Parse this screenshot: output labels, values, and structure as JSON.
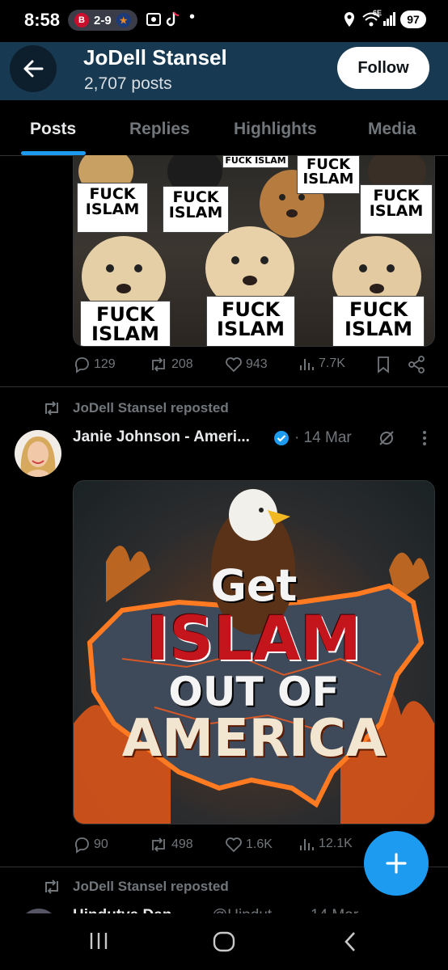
{
  "status_bar": {
    "time": "8:58",
    "score": "2-9",
    "team1_letter": "B",
    "team2_letter": "★",
    "network": "6E",
    "battery": "97"
  },
  "header": {
    "name": "JoDell Stansel",
    "posts_count": "2,707 posts",
    "follow_label": "Follow"
  },
  "tabs": [
    "Posts",
    "Replies",
    "Highlights",
    "Media"
  ],
  "post1": {
    "image_signs": [
      "FUCK ISLAM",
      "FUCK ISLAM",
      "FUCK ISLAM",
      "FUCK ISLAM",
      "FUCK ISLAM",
      "FUCK ISLAM",
      "FUCK ISLAM",
      "FUCK ISLAM"
    ],
    "replies": "129",
    "reposts": "208",
    "likes": "943",
    "views": "7.7K"
  },
  "post2": {
    "repost_label": "JoDell Stansel reposted",
    "author": "Janie Johnson - Ameri...",
    "date": "· 14 Mar",
    "image_text": {
      "line1": "Get",
      "line2": "ISLAM",
      "line3": "OUT OF",
      "line4": "AMERICA"
    },
    "replies": "90",
    "reposts": "498",
    "likes": "1.6K",
    "views": "12.1K"
  },
  "post3": {
    "repost_label": "JoDell Stansel reposted",
    "author_partial": "Hindutva Dan",
    "handle_partial": "@Hindut",
    "date_partial": "14 Mar"
  },
  "colors": {
    "accent": "#1d9bf0",
    "header_bg": "#173a52",
    "muted": "#71767b"
  }
}
